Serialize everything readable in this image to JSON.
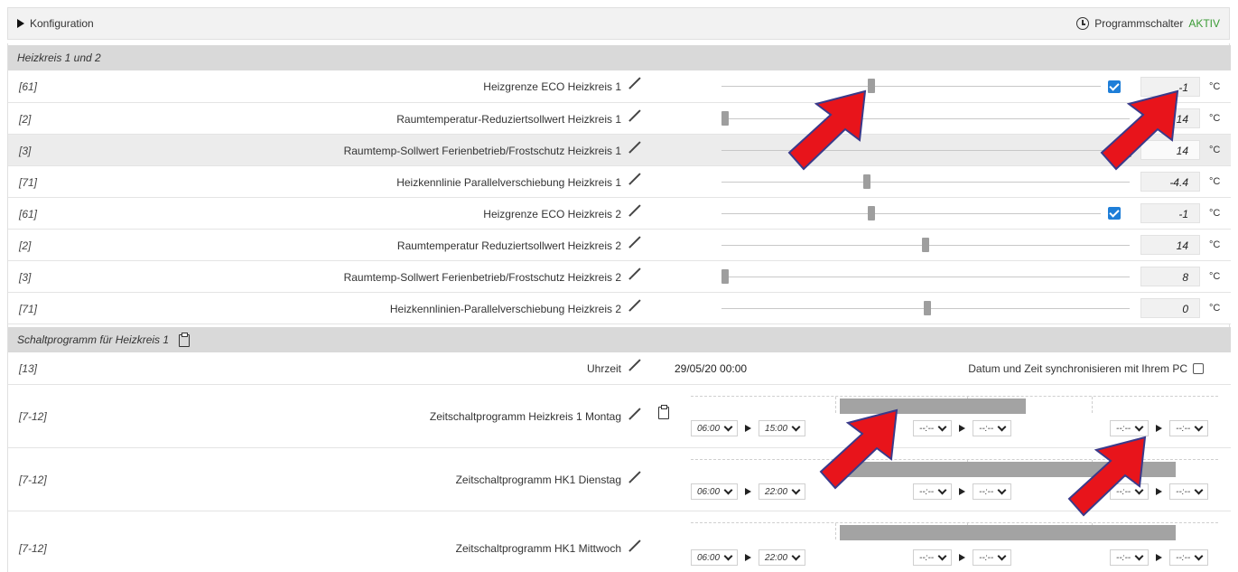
{
  "topbar": {
    "config_label": "Konfiguration",
    "program_label": "Programmschalter",
    "program_status": "AKTIV"
  },
  "heizkreis": {
    "title": "Heizkreis 1 und 2",
    "rows": [
      {
        "id": "[61]",
        "label": "Heizgrenze ECO Heizkreis 1",
        "value": "-1",
        "unit": "°C",
        "checkbox": true
      },
      {
        "id": "[2]",
        "label": "Raumtemperatur-Reduziertsollwert Heizkreis 1",
        "value": "14",
        "unit": "°C",
        "checkbox": false
      },
      {
        "id": "[3]",
        "label": "Raumtemp-Sollwert Ferienbetrieb/Frostschutz Heizkreis 1",
        "value": "14",
        "unit": "°C",
        "checkbox": false
      },
      {
        "id": "[71]",
        "label": "Heizkennlinie Parallelverschiebung Heizkreis 1",
        "value": "-4.4",
        "unit": "°C",
        "checkbox": false
      },
      {
        "id": "[61]",
        "label": "Heizgrenze ECO Heizkreis 2",
        "value": "-1",
        "unit": "°C",
        "checkbox": true
      },
      {
        "id": "[2]",
        "label": "Raumtemperatur Reduziertsollwert Heizkreis 2",
        "value": "14",
        "unit": "°C",
        "checkbox": false
      },
      {
        "id": "[3]",
        "label": "Raumtemp-Sollwert Ferienbetrieb/Frostschutz Heizkreis 2",
        "value": "8",
        "unit": "°C",
        "checkbox": false
      },
      {
        "id": "[71]",
        "label": "Heizkennlinien-Parallelverschiebung Heizkreis 2",
        "value": "0",
        "unit": "°C",
        "checkbox": false
      }
    ]
  },
  "schaltprogramm": {
    "title": "Schaltprogramm für Heizkreis 1",
    "uhrzeit": {
      "id": "[13]",
      "label": "Uhrzeit",
      "value": "29/05/20 00:00",
      "sync_label": "Datum und Zeit synchronisieren mit Ihrem PC"
    },
    "days": [
      {
        "id": "[7-12]",
        "label": "Zeitschaltprogramm Heizkreis 1 Montag",
        "p1_start": "06:00",
        "p1_end": "15:00",
        "p2_start": "--:--",
        "p2_end": "--:--",
        "p3_start": "--:--",
        "p3_end": "--:--"
      },
      {
        "id": "[7-12]",
        "label": "Zeitschaltprogramm HK1 Dienstag",
        "p1_start": "06:00",
        "p1_end": "22:00",
        "p2_start": "--:--",
        "p2_end": "--:--",
        "p3_start": "--:--",
        "p3_end": "--:--"
      },
      {
        "id": "[7-12]",
        "label": "Zeitschaltprogramm HK1 Mittwoch",
        "p1_start": "06:00",
        "p1_end": "22:00",
        "p2_start": "--:--",
        "p2_end": "--:--",
        "p3_start": "--:--",
        "p3_end": "--:--"
      }
    ]
  },
  "colors": {
    "accent_checkbox": "#1e7ed8",
    "active_green": "#3a9b35",
    "annotation_arrow": "#e8141b"
  }
}
